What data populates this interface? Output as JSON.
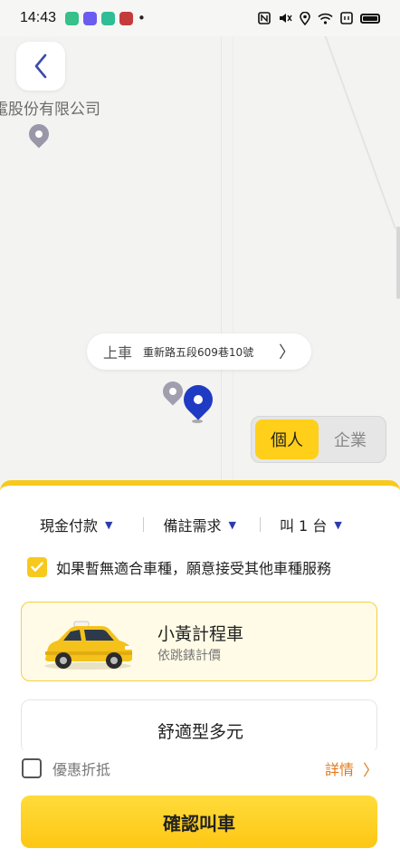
{
  "status_bar": {
    "time": "14:43",
    "dot": "•",
    "app_icon_colors": [
      "#36c08a",
      "#6b5cf0",
      "#2fbd95",
      "#c43b3b"
    ],
    "right_icons": [
      "nfc-icon",
      "mute-icon",
      "location-icon",
      "wifi-icon",
      "data-icon",
      "battery-icon"
    ]
  },
  "map": {
    "back_icon": "chevron-left-icon",
    "company_label": "電股份有限公司",
    "pickup": {
      "tag": "上車",
      "address": "重新路五段609巷10號",
      "arrow": "〉"
    },
    "account_toggle": {
      "personal": "個人",
      "business": "企業",
      "selected": "personal"
    }
  },
  "options": {
    "payment": "現金付款",
    "note": "備註需求",
    "count": "叫 1 台"
  },
  "accept_other": {
    "checked": true,
    "label": "如果暫無適合車種，願意接受其他車種服務"
  },
  "vehicles": [
    {
      "title": "小黃計程車",
      "subtitle": "依跳錶計價",
      "selected": true
    },
    {
      "title": "舒適型多元",
      "subtitle": "",
      "selected": false
    }
  ],
  "discount": {
    "checked": false,
    "label": "優惠折抵",
    "details": "詳情",
    "details_chevron": "〉"
  },
  "confirm": {
    "label": "確認叫車"
  },
  "colors": {
    "accent_yellow": "#f7c91c",
    "accent_blue": "#1f3bc4",
    "link_orange": "#e07a1b"
  }
}
